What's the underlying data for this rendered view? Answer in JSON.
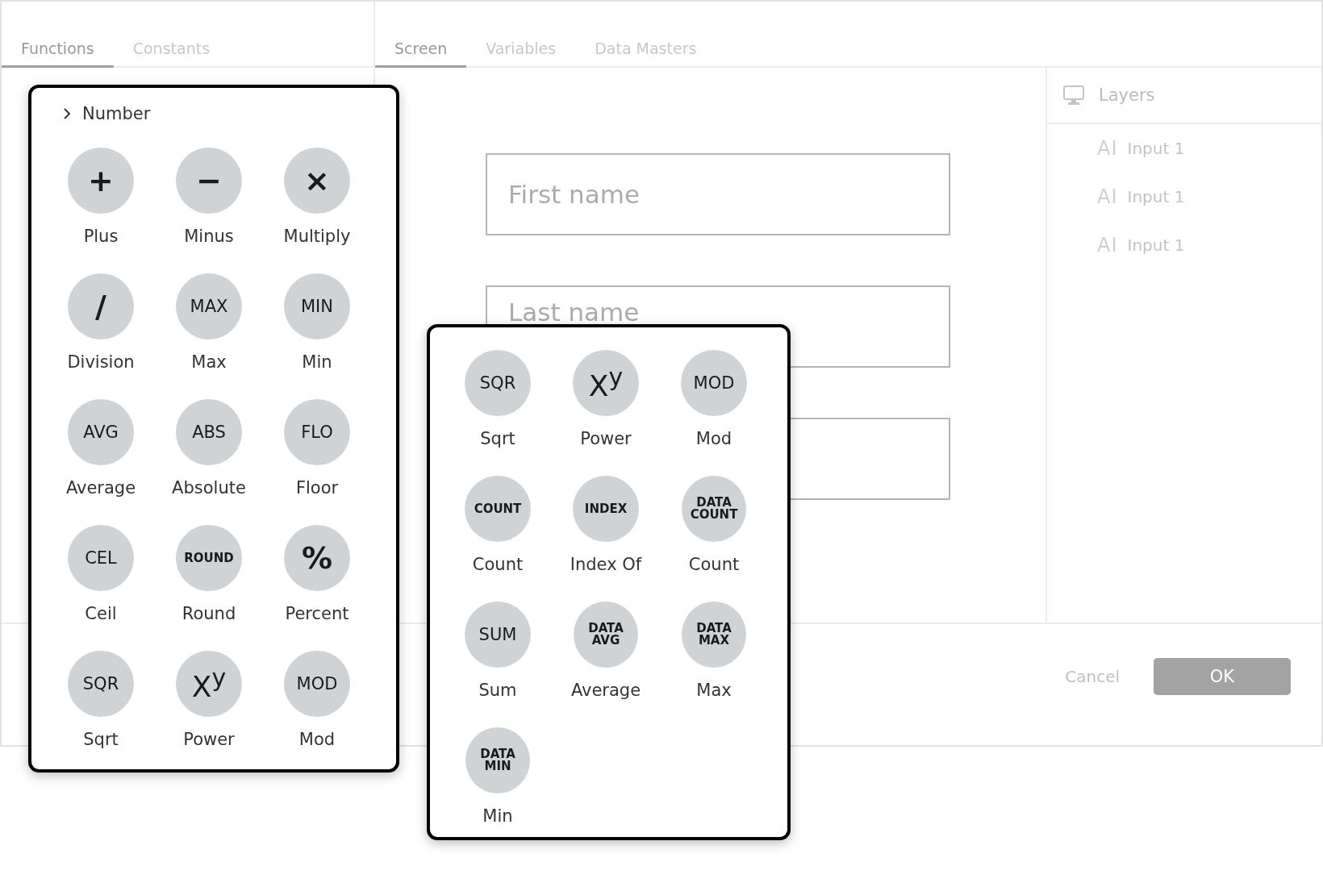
{
  "left_tabs": [
    {
      "label": "Functions",
      "selected": true
    },
    {
      "label": "Constants",
      "selected": false
    }
  ],
  "right_tabs": [
    {
      "label": "Screen",
      "selected": true
    },
    {
      "label": "Variables",
      "selected": false
    },
    {
      "label": "Data Masters",
      "selected": false
    }
  ],
  "fields": [
    {
      "placeholder": "First name"
    },
    {
      "placeholder": "Last name"
    }
  ],
  "layers": {
    "title": "Layers",
    "items": [
      {
        "icon": "AI",
        "label": "Input 1"
      },
      {
        "icon": "AI",
        "label": "Input 1"
      },
      {
        "icon": "AI",
        "label": "Input 1"
      }
    ]
  },
  "footer": {
    "cancel": "Cancel",
    "ok": "OK"
  },
  "popups": [
    {
      "header": "Number",
      "items": [
        {
          "badge": "+",
          "label": "Plus"
        },
        {
          "badge": "−",
          "label": "Minus"
        },
        {
          "badge": "×",
          "label": "Multiply"
        },
        {
          "badge": "/",
          "label": "Division"
        },
        {
          "badge": "MAX",
          "label": "Max"
        },
        {
          "badge": "MIN",
          "label": "Min"
        },
        {
          "badge": "AVG",
          "label": "Average"
        },
        {
          "badge": "ABS",
          "label": "Absolute"
        },
        {
          "badge": "FLO",
          "label": "Floor"
        },
        {
          "badge": "CEL",
          "label": "Ceil"
        },
        {
          "badge": "ROUND",
          "label": "Round"
        },
        {
          "badge": "%",
          "label": "Percent"
        },
        {
          "badge": "SQR",
          "label": "Sqrt"
        },
        {
          "badge": "X$^{y}$",
          "label": "Power"
        },
        {
          "badge": "MOD",
          "label": "Mod"
        }
      ]
    },
    {
      "items": [
        {
          "badge": "SQR",
          "label": "Sqrt"
        },
        {
          "badge": "X$^{y}$",
          "label": "Power"
        },
        {
          "badge": "MOD",
          "label": "Mod"
        },
        {
          "badge": "COUNT",
          "label": "Count"
        },
        {
          "badge": "INDEX",
          "label": "Index Of"
        },
        {
          "badge": "DATA COUNT",
          "label": "Count"
        },
        {
          "badge": "SUM",
          "label": "Sum"
        },
        {
          "badge": "DATA AVG",
          "label": "Average"
        },
        {
          "badge": "DATA MAX",
          "label": "Max"
        },
        {
          "badge": "DATA MIN",
          "label": "Min"
        }
      ]
    }
  ]
}
